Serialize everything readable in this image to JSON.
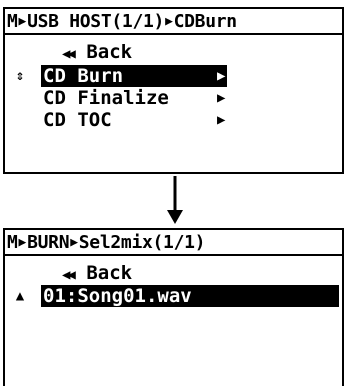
{
  "top": {
    "title": {
      "mode": "M",
      "path1": "USB HOST(1/1)",
      "path2": "CDBurn"
    },
    "back_label": "Back",
    "menu_items": [
      {
        "label": "CD Burn",
        "selected": true
      },
      {
        "label": "CD Finalize",
        "selected": false
      },
      {
        "label": "CD TOC",
        "selected": false
      }
    ]
  },
  "bottom": {
    "title": {
      "mode": "M",
      "path1": "BURN",
      "path2": "Sel2mix(1/1)"
    },
    "back_label": "Back",
    "files": [
      {
        "label": "01:Song01.wav",
        "selected": true
      }
    ]
  },
  "icons": {
    "back": "double-left-triangle",
    "submenu": "right-triangle",
    "scroll": "up-down-arrow",
    "file_marker": "up-triangle",
    "flow": "down-arrow"
  },
  "colors": {
    "foreground": "#000000",
    "background": "#ffffff",
    "highlight_text": "#ffffff"
  }
}
